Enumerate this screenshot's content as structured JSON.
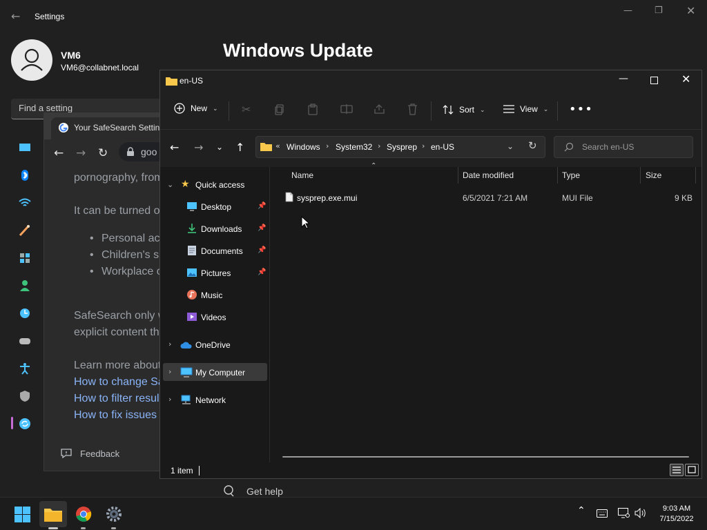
{
  "settings": {
    "title": "Settings",
    "user_name": "VM6",
    "user_email": "VM6@collabnet.local",
    "search_placeholder": "Find a setting",
    "page_title": "Windows Update",
    "get_help": "Get help"
  },
  "chrome": {
    "tab_title": "Your SafeSearch Setting",
    "omnibox": "goo",
    "body": {
      "line1": "pornography, from",
      "line2": "It can be turned o",
      "bullets": [
        "Personal ac",
        "Children's s",
        "Workplace o"
      ],
      "para1": "SafeSearch only w",
      "para2": "explicit content th",
      "learn": "Learn more about",
      "links": [
        "How to change Sa",
        "How to filter resul",
        "How to fix issues "
      ]
    },
    "feedback": "Feedback"
  },
  "explorer": {
    "title": "en-US",
    "toolbar": {
      "new": "New",
      "sort": "Sort",
      "view": "View"
    },
    "address": [
      "Windows",
      "System32",
      "Sysprep",
      "en-US"
    ],
    "search_placeholder": "Search en-US",
    "nav": {
      "quick_access": "Quick access",
      "pinned": [
        "Desktop",
        "Downloads",
        "Documents",
        "Pictures"
      ],
      "unpinned": [
        "Music",
        "Videos"
      ],
      "onedrive": "OneDrive",
      "my_computer": "My Computer",
      "network": "Network"
    },
    "columns": [
      "Name",
      "Date modified",
      "Type",
      "Size"
    ],
    "files": [
      {
        "name": "sysprep.exe.mui",
        "date": "6/5/2021 7:21 AM",
        "type": "MUI File",
        "size": "9 KB"
      }
    ],
    "status": "1 item"
  },
  "taskbar": {
    "time": "9:03 AM",
    "date": "7/15/2022"
  },
  "colors": {
    "accent": "#60cdff",
    "folder": "#f8c84c",
    "background": "#202020"
  }
}
